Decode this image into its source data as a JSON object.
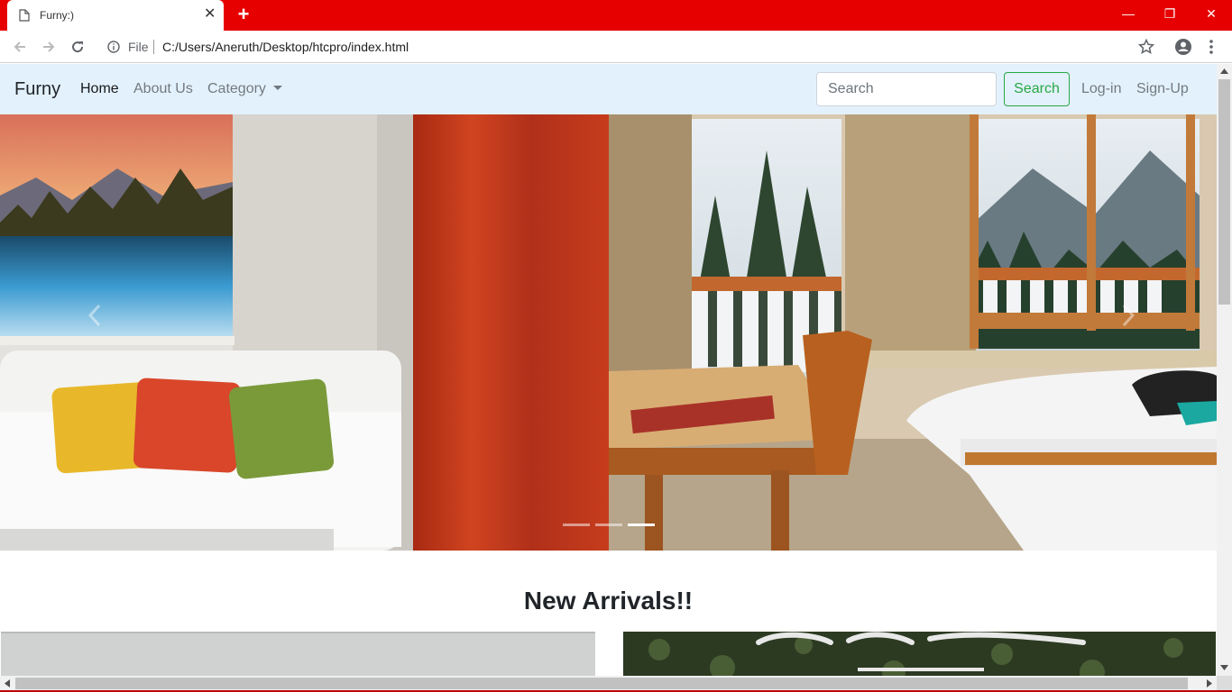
{
  "browser": {
    "tab_title": "Furny:)",
    "tab_close": "✕",
    "new_tab": "+",
    "scheme": "File",
    "url": "C:/Users/Aneruth/Desktop/htcpro/index.html",
    "window_minimize": "—",
    "window_restore": "❐",
    "window_close": "✕",
    "accent_color": "#e60000"
  },
  "navbar": {
    "brand": "Furny",
    "links": [
      "Home",
      "About Us",
      "Category"
    ],
    "search_placeholder": "Search",
    "search_button": "Search",
    "login": "Log-in",
    "signup": "Sign-Up",
    "background": "#e3f1fc"
  },
  "carousel": {
    "indicator_count": 3,
    "active_indicator": 3
  },
  "arrivals": {
    "heading": "New Arrivals!!"
  }
}
